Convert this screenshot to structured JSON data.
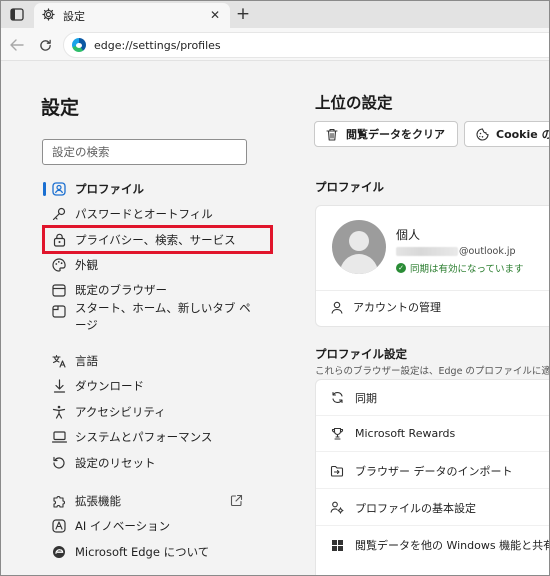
{
  "browser": {
    "tab_title": "設定",
    "tab_close": "✕",
    "new_tab": "+",
    "url": "edge://settings/profiles"
  },
  "sidebar": {
    "title": "設定",
    "search_placeholder": "設定の検索",
    "items": [
      {
        "label": "プロファイル",
        "icon": "person-circle-icon",
        "active": true
      },
      {
        "label": "パスワードとオートフィル",
        "icon": "key-icon"
      },
      {
        "label": "プライバシー、検索、サービス",
        "icon": "lock-icon",
        "highlighted": true
      },
      {
        "label": "外観",
        "icon": "palette-icon"
      },
      {
        "label": "既定のブラウザー",
        "icon": "browser-window-icon"
      },
      {
        "label": "スタート、ホーム、新しいタブ ページ",
        "icon": "home-tabs-icon"
      },
      {
        "label": "言語",
        "icon": "language-icon"
      },
      {
        "label": "ダウンロード",
        "icon": "download-icon"
      },
      {
        "label": "アクセシビリティ",
        "icon": "accessibility-icon"
      },
      {
        "label": "システムとパフォーマンス",
        "icon": "laptop-icon"
      },
      {
        "label": "設定のリセット",
        "icon": "reset-icon"
      },
      {
        "label": "拡張機能",
        "icon": "puzzle-icon",
        "external": true
      },
      {
        "label": "AI イノベーション",
        "icon": "ai-icon"
      },
      {
        "label": "Microsoft Edge について",
        "icon": "edge-logo-icon"
      }
    ]
  },
  "main": {
    "title": "上位の設定",
    "top_buttons": [
      {
        "label": "閲覧データをクリア",
        "icon": "trash-icon"
      },
      {
        "label": "Cookie の管",
        "icon": "cookie-icon"
      }
    ],
    "profiles_label": "プロファイル",
    "profile": {
      "name": "個人",
      "email_suffix": "@outlook.jp",
      "sync_status": "同期は有効になっています",
      "manage_account": "アカウントの管理"
    },
    "profile_settings_label": "プロファイル設定",
    "profile_settings_desc": "これらのブラウザー設定は、Edge のプロファイルに適",
    "profile_settings": [
      {
        "label": "同期",
        "icon": "sync-icon"
      },
      {
        "label": "Microsoft Rewards",
        "icon": "trophy-icon"
      },
      {
        "label": "ブラウザー データのインポート",
        "icon": "import-icon"
      },
      {
        "label": "プロファイルの基本設定",
        "icon": "people-settings-icon"
      },
      {
        "label": "閲覧データを他の Windows 機能と共有",
        "icon": "windows-icon"
      }
    ]
  },
  "colors": {
    "accent": "#1a6fd1",
    "highlight": "#e0142b",
    "sync_ok": "#2a8c36"
  }
}
